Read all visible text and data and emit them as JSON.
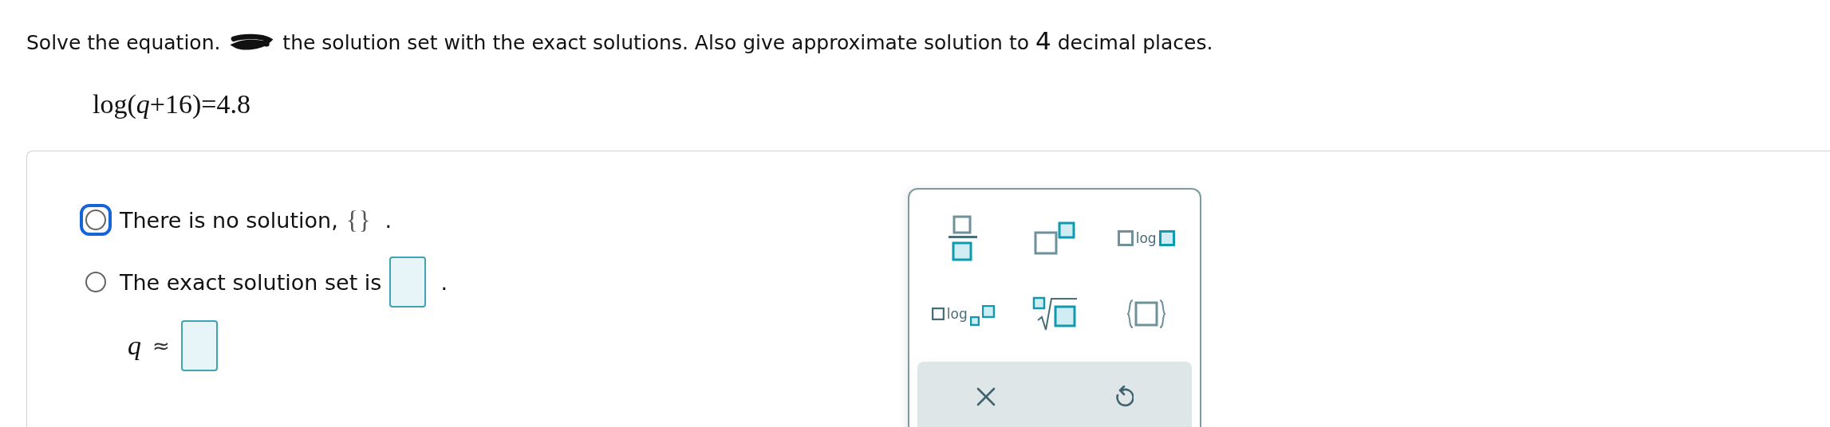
{
  "instruction": {
    "before": "Solve the equation.",
    "after": "the solution set with the exact solutions. Also give approximate solution to",
    "number": "4",
    "end": "decimal places."
  },
  "equation": "log(*q*+16)=4.8",
  "options": [
    {
      "label": "There is no solution,",
      "symbol": "{}",
      "end": ".",
      "kind": "symbol",
      "selected": false,
      "focused": true
    },
    {
      "label": "The exact solution set is",
      "end": ".",
      "kind": "field",
      "selected": false,
      "focused": false
    }
  ],
  "approximation": {
    "variable": "q",
    "relation": "≈"
  },
  "palette": {
    "keys": [
      {
        "kind": "fraction"
      },
      {
        "kind": "power"
      },
      {
        "kind": "log",
        "label": "log"
      },
      {
        "kind": "log_base",
        "label": "log"
      },
      {
        "kind": "nth_root"
      },
      {
        "kind": "set"
      }
    ],
    "actions": [
      {
        "kind": "clear"
      },
      {
        "kind": "undo"
      }
    ]
  }
}
